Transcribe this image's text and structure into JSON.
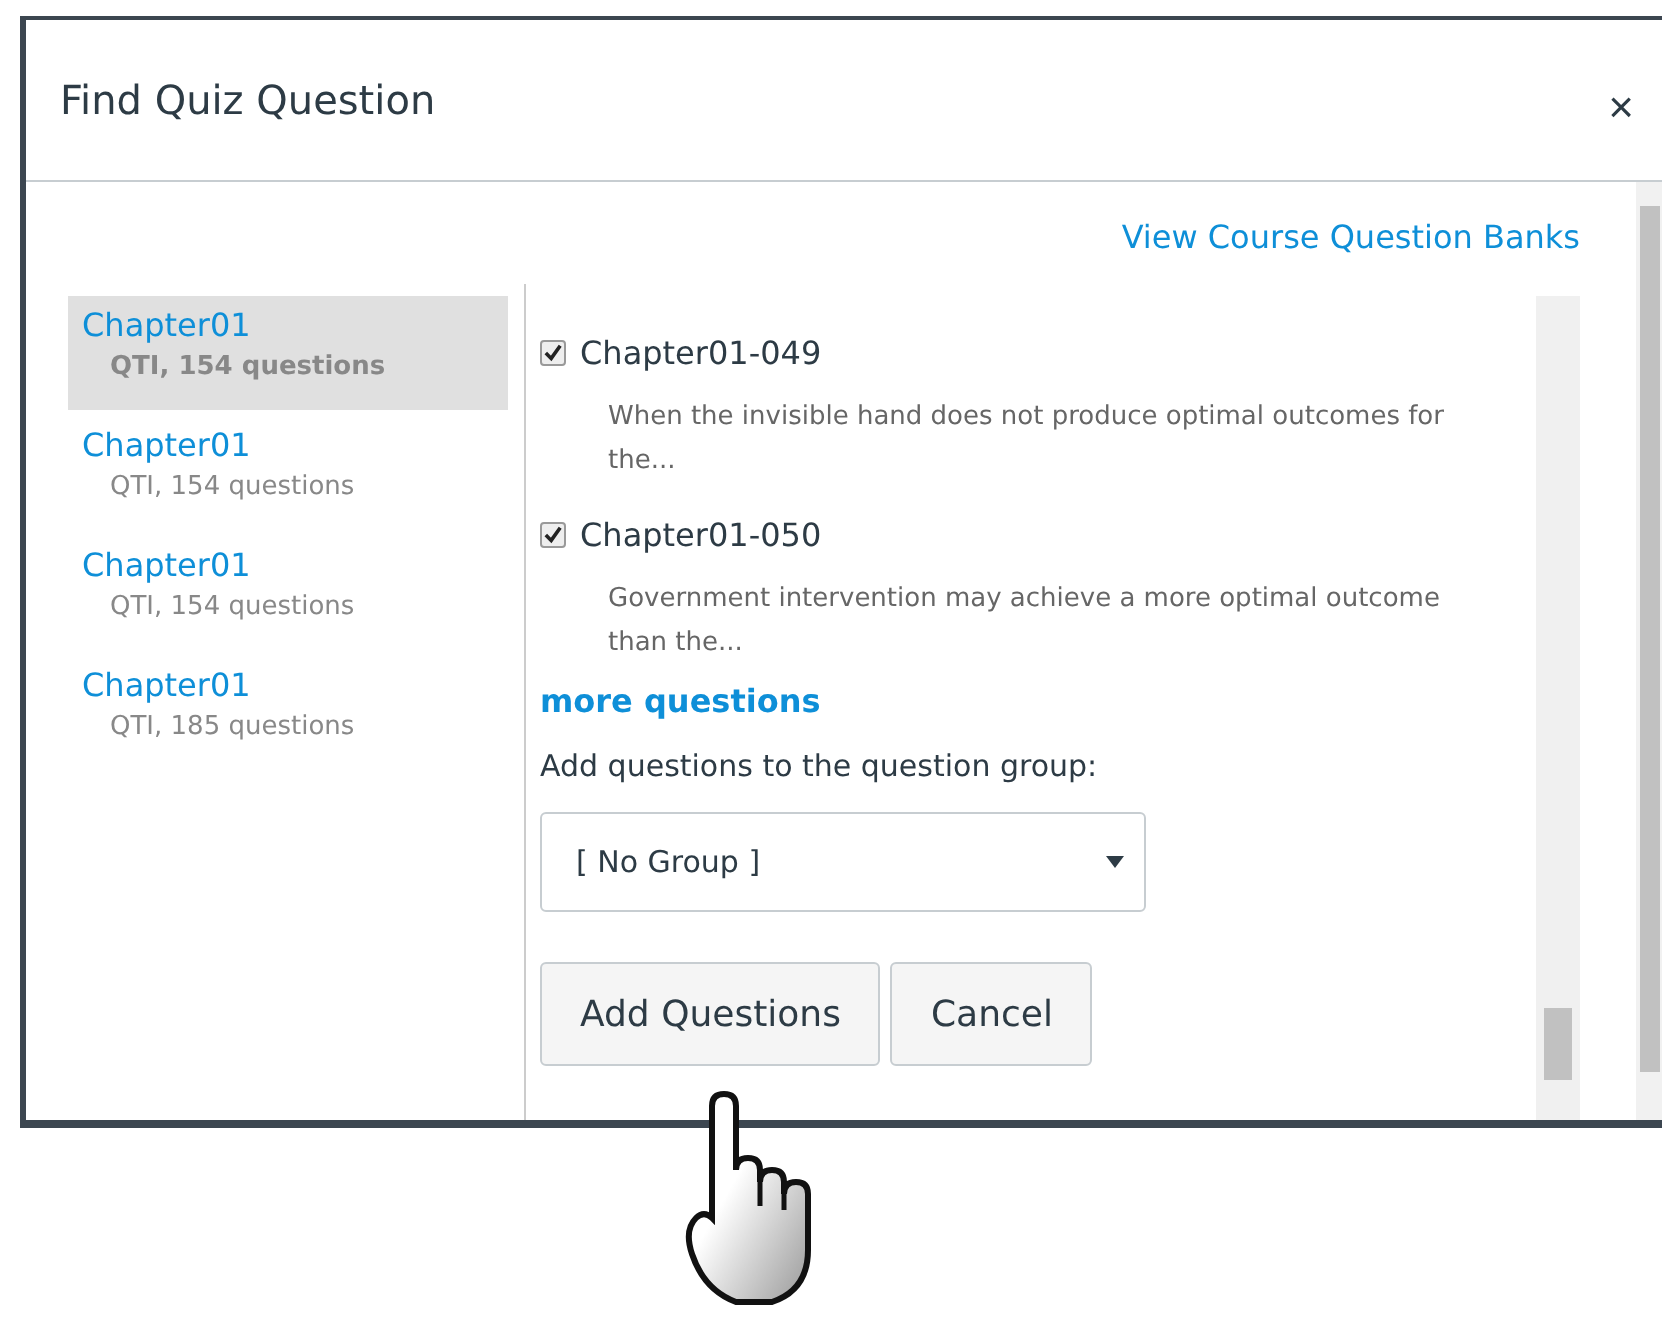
{
  "dialog": {
    "title": "Find Quiz Question",
    "close": "×"
  },
  "banks_link": "View Course Question Banks",
  "banks": [
    {
      "name": "Chapter01",
      "meta": "QTI, 154 questions",
      "selected": true
    },
    {
      "name": "Chapter01",
      "meta": "QTI, 154 questions",
      "selected": false
    },
    {
      "name": "Chapter01",
      "meta": "QTI, 154 questions",
      "selected": false
    },
    {
      "name": "Chapter01",
      "meta": "QTI, 185 questions",
      "selected": false
    }
  ],
  "questions": [
    {
      "name": "Chapter01-049",
      "checked": true,
      "text": "When the invisible hand does not produce optimal outcomes for the..."
    },
    {
      "name": "Chapter01-050",
      "checked": true,
      "text": "Government intervention may achieve a more optimal outcome than the..."
    }
  ],
  "more_link": "more questions",
  "group_label": "Add questions to the question group:",
  "group_select": {
    "value": "[ No Group ]"
  },
  "buttons": [
    {
      "label": "Add Questions"
    },
    {
      "label": "Cancel"
    }
  ]
}
